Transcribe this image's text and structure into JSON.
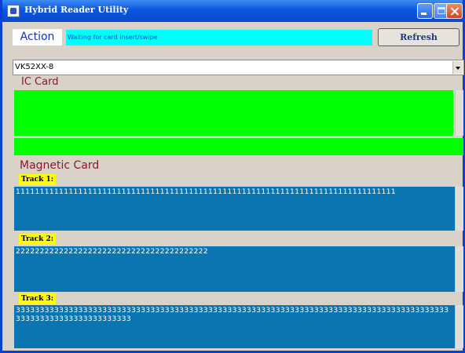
{
  "window": {
    "title": "Hybrid Reader Utility"
  },
  "action": {
    "label": "Action",
    "status": "Waiting for card insert/swipe",
    "refresh_label": "Refresh"
  },
  "device": {
    "selected": "VK52XX-8"
  },
  "ic_card": {
    "heading": "IC Card"
  },
  "magnetic_card": {
    "heading": "Magnetic Card",
    "tracks": [
      {
        "label": "Track 1:",
        "value": "1111111111111111111111111111111111111111111111111111111111111111111111111111111"
      },
      {
        "label": "Track 2:",
        "value": "2222222222222222222222222222222222222222"
      },
      {
        "label": "Track 3:",
        "value": "333333333333333333333333333333333333333333333333333333333333333333333333333333333333333333333333333333333333333333"
      }
    ]
  },
  "colors": {
    "titlebar": "#0b56e0",
    "status_bg": "#00ffff",
    "ic_card_bg": "#00ff00",
    "track_bg": "#0b75b2",
    "track_label_bg": "#ffff00",
    "heading_text": "#8a1a2a"
  },
  "icons": [
    "app-icon",
    "minimize-icon",
    "maximize-icon",
    "close-icon",
    "chevron-down-icon"
  ]
}
